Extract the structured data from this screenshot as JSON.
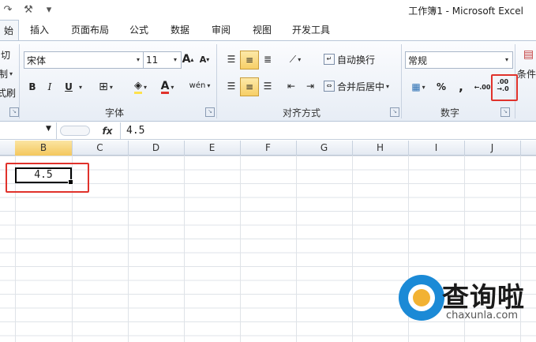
{
  "window": {
    "title": "工作簿1 - Microsoft Excel"
  },
  "tabs": [
    {
      "label": "始",
      "active": true
    },
    {
      "label": "插入"
    },
    {
      "label": "页面布局"
    },
    {
      "label": "公式"
    },
    {
      "label": "数据"
    },
    {
      "label": "审阅"
    },
    {
      "label": "视图"
    },
    {
      "label": "开发工具"
    }
  ],
  "clipboard": {
    "cut": "切",
    "copy": "制",
    "format_painter": "式刷"
  },
  "font": {
    "name": "宋体",
    "size": "11",
    "grow": "A",
    "shrink": "A",
    "bold": "B",
    "italic": "I",
    "underline": "U",
    "phonetic": "wén",
    "group_label": "字体"
  },
  "alignment": {
    "wrap_text": "自动换行",
    "merge_center": "合并后居中",
    "group_label": "对齐方式"
  },
  "number": {
    "format": "常规",
    "percent": "%",
    "comma": ",",
    "increase_decimal": ".00",
    "group_label": "数字"
  },
  "styles": {
    "conditional": "条件"
  },
  "formula_bar": {
    "fx": "fx",
    "value": "4.5"
  },
  "columns": [
    "B",
    "C",
    "D",
    "E",
    "F",
    "G",
    "H",
    "I",
    "J"
  ],
  "cell": {
    "ref": "B1",
    "value": "4.5"
  },
  "watermark": {
    "text": "查询啦",
    "url": "chaxunla.com"
  },
  "colors": {
    "accent": "#f4c75d",
    "highlight": "#e0322b",
    "font_color": "#e0322b",
    "fill_color": "#ffe14d"
  }
}
